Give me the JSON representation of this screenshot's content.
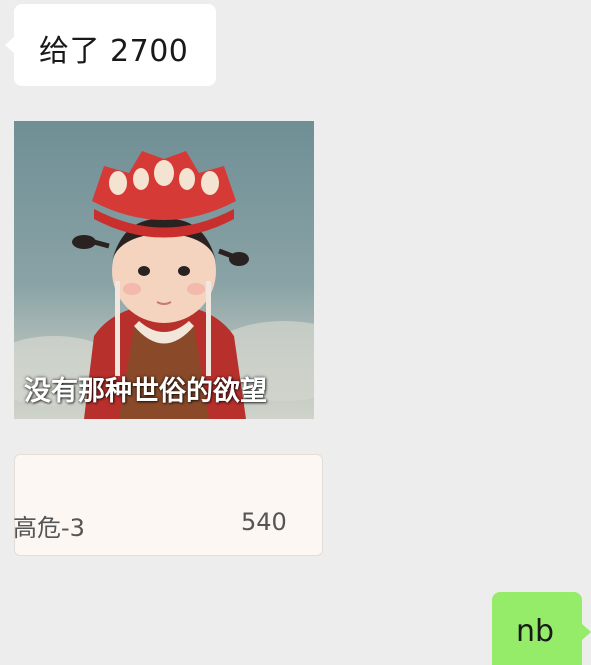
{
  "messages": {
    "incoming_text": "给了 2700",
    "sticker_caption": "没有那种世俗的欲望",
    "card": {
      "label": "高危-3",
      "value": "540"
    },
    "outgoing_text": "nb"
  },
  "colors": {
    "background": "#ededed",
    "incoming_bubble": "#ffffff",
    "outgoing_bubble": "#95ec69",
    "card_background": "#fdf7f3"
  }
}
